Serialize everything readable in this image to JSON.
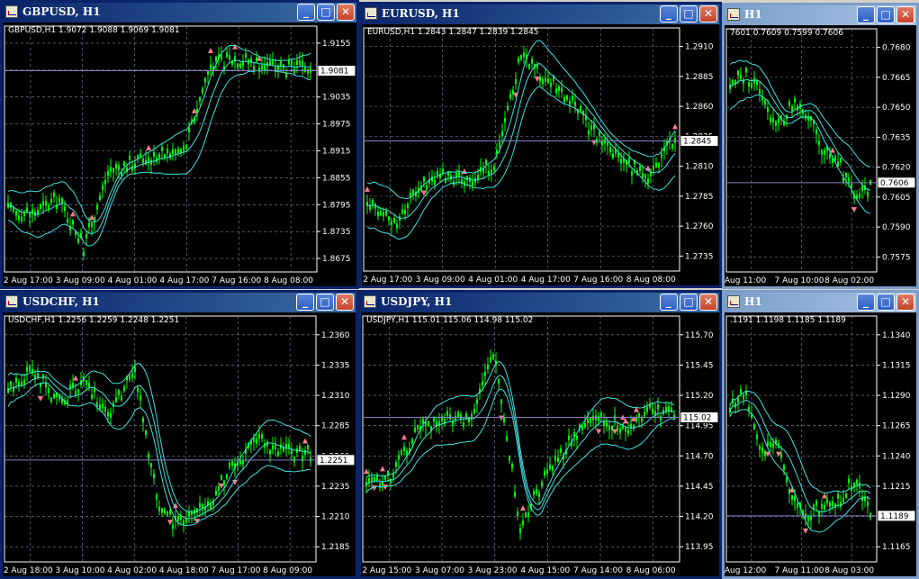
{
  "colors": {
    "candle": "#00ff00",
    "bands": "#40e0e0",
    "fractal": "#ff7890",
    "grid": "#7f8fa8",
    "axis": "#ffffff",
    "priceLine": "#8080c0"
  },
  "windows": [
    {
      "id": "gbpusd",
      "title": "GBPUSD, H1",
      "info": "GBPUSD,H1  1.9072 1.9088 1.9069 1.9081",
      "yticks": [
        "1.9155",
        "1.9095",
        "1.9035",
        "1.8975",
        "1.8915",
        "1.8855",
        "1.8795",
        "1.8735",
        "1.8675"
      ],
      "xticks": [
        "2 Aug 17:00",
        "3 Aug 09:00",
        "4 Aug 01:00",
        "4 Aug 17:00",
        "7 Aug 16:00",
        "8 Aug 08:00"
      ],
      "price": "1.9081",
      "trend": [
        0.25,
        0.24,
        0.3,
        0.1,
        0.42,
        0.45,
        0.48,
        0.5,
        0.85,
        0.88,
        0.86,
        0.84,
        0.83
      ]
    },
    {
      "id": "eurusd",
      "title": "EURUSD, H1",
      "info": "EURUSD,H1  1.2843 1.2847 1.2839 1.2845",
      "yticks": [
        "1.2910",
        "1.2885",
        "1.2860",
        "1.2835",
        "1.2810",
        "1.2785",
        "1.2760",
        "1.2735"
      ],
      "xticks": [
        "2 Aug 17:00",
        "3 Aug 09:00",
        "4 Aug 01:00",
        "4 Aug 17:00",
        "7 Aug 16:00",
        "8 Aug 08:00"
      ],
      "price": "1.2845",
      "trend": [
        0.3,
        0.18,
        0.35,
        0.4,
        0.38,
        0.45,
        0.9,
        0.8,
        0.7,
        0.55,
        0.45,
        0.4,
        0.55
      ]
    },
    {
      "id": "h1right",
      "title": "H1",
      "info": "7601 0.7609 0.7599 0.7606",
      "yticks": [
        "0.7680",
        "0.7665",
        "0.7650",
        "0.7635",
        "0.7620",
        "0.7605",
        "0.7590",
        "0.7575"
      ],
      "xticks": [
        "Aug 11:00",
        "7 Aug 10:00",
        "8 Aug 02:00"
      ],
      "price": "0.7606",
      "trend": [
        0.78,
        0.82,
        0.75,
        0.6,
        0.7,
        0.65,
        0.5,
        0.45,
        0.3,
        0.35
      ]
    },
    {
      "id": "usdchf",
      "title": "USDCHF, H1",
      "info": "USDCHF,H1  1.2256 1.2259 1.2248 1.2251",
      "yticks": [
        "1.2360",
        "1.2335",
        "1.2310",
        "1.2285",
        "1.2260",
        "1.2235",
        "1.2210",
        "1.2185"
      ],
      "xticks": [
        "2 Aug 18:00",
        "3 Aug 10:00",
        "4 Aug 02:00",
        "4 Aug 18:00",
        "7 Aug 17:00",
        "8 Aug 09:00"
      ],
      "price": "1.2251",
      "trend": [
        0.7,
        0.8,
        0.65,
        0.75,
        0.6,
        0.8,
        0.2,
        0.15,
        0.25,
        0.4,
        0.5,
        0.45,
        0.45
      ]
    },
    {
      "id": "usdjpy",
      "title": "USDJPY, H1",
      "info": "USDJPY,H1  115.01 115.06 114.98 115.02",
      "yticks": [
        "115.70",
        "115.45",
        "115.20",
        "114.95",
        "114.70",
        "114.45",
        "114.20",
        "113.95"
      ],
      "xticks": [
        "2 Aug 15:00",
        "3 Aug 07:00",
        "3 Aug 23:00",
        "4 Aug 15:00",
        "7 Aug 14:00",
        "8 Aug 06:00"
      ],
      "price": "115.02",
      "trend": [
        0.3,
        0.35,
        0.55,
        0.6,
        0.58,
        0.85,
        0.15,
        0.35,
        0.5,
        0.6,
        0.55,
        0.62,
        0.6
      ]
    },
    {
      "id": "h1rightb",
      "title": "H1",
      "info": ".1191 1.1198 1.1185 1.1189",
      "yticks": [
        "1.1340",
        "1.1315",
        "1.1290",
        "1.1265",
        "1.1240",
        "1.1215",
        "1.1190",
        "1.1165"
      ],
      "xticks": [
        "Aug 12:00",
        "7 Aug 11:00",
        "8 Aug 03:00"
      ],
      "price": "1.1189",
      "trend": [
        0.65,
        0.7,
        0.45,
        0.5,
        0.25,
        0.2,
        0.22,
        0.25,
        0.35,
        0.2
      ]
    }
  ],
  "titlebar_buttons": {
    "minimize": "_",
    "maximize": "□",
    "close": "✕"
  }
}
